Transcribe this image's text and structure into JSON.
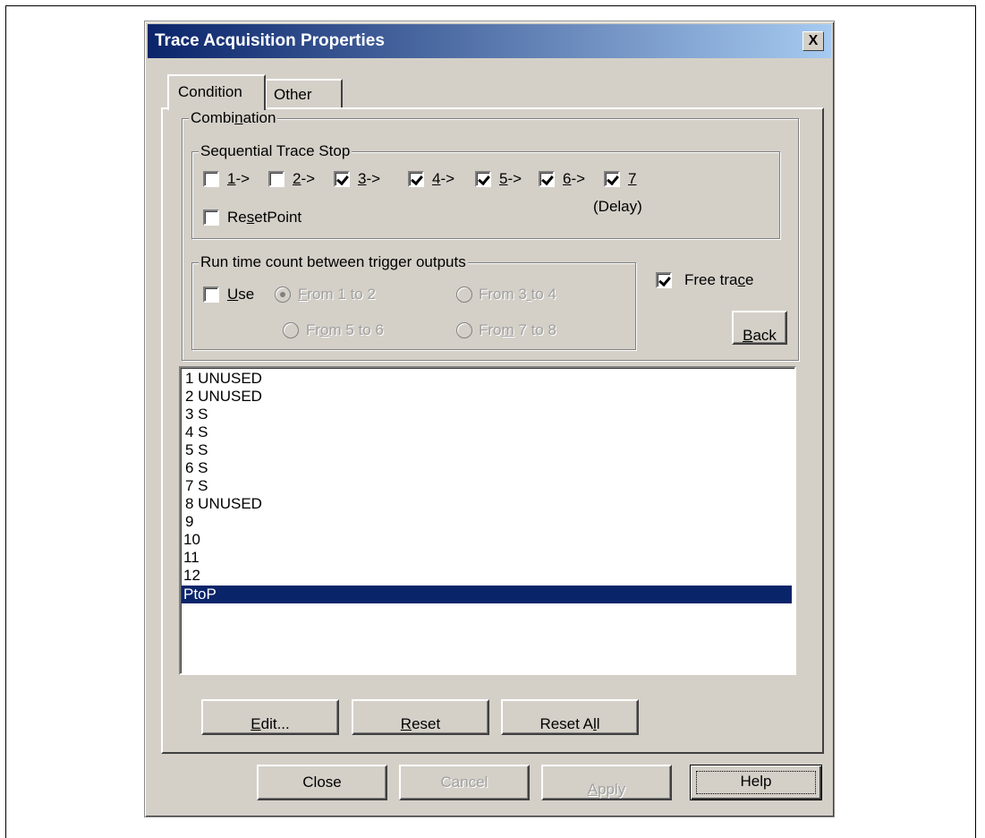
{
  "dialog": {
    "title": "Trace Acquisition Properties",
    "close_glyph": "X"
  },
  "tabs": [
    {
      "label": "Condition"
    },
    {
      "label": "Other"
    }
  ],
  "combination": {
    "label_pre": "Combi",
    "label_u": "n",
    "label_post": "ation"
  },
  "seq": {
    "label": "Sequential Trace Stop",
    "steps": [
      {
        "num": "1",
        "suffix": "->",
        "checked": false
      },
      {
        "num": "2",
        "suffix": "->",
        "checked": false
      },
      {
        "num": "3",
        "suffix": "->",
        "checked": true
      },
      {
        "num": "4",
        "suffix": "->",
        "checked": true
      },
      {
        "num": "5",
        "suffix": "->",
        "checked": true
      },
      {
        "num": "6",
        "suffix": "->",
        "checked": true
      },
      {
        "num": "7",
        "suffix": "",
        "checked": true
      }
    ],
    "delay": "(Delay)",
    "reset_pre": "Re",
    "reset_u": "s",
    "reset_post": "etPoint",
    "reset_checked": false
  },
  "runtime": {
    "label": "Run time count between trigger outputs",
    "use_u": "U",
    "use_post": "se",
    "use_checked": false,
    "from12_u": "F",
    "from12_post": "rom 1 to 2",
    "from34_pre": "From 3",
    "from34_u": " ",
    "from34_post": "to 4",
    "from56_pre": "Fr",
    "from56_u": "o",
    "from56_post": "m 5 to 6",
    "from78_pre": "Fro",
    "from78_u": "m",
    "from78_post": " 7 to 8"
  },
  "free_trace": {
    "pre": "Free tra",
    "u": "c",
    "post": "e",
    "checked": true
  },
  "back_button": {
    "u": "B",
    "post": "ack"
  },
  "list": {
    "items": [
      "1 UNUSED",
      "2 UNUSED",
      "3 S",
      "4 S",
      "5 S",
      "6 S",
      "7 S",
      "8 UNUSED",
      "9",
      "10",
      "11",
      "12",
      "PtoP"
    ],
    "selected_index": 12
  },
  "panel_buttons": {
    "edit_u": "E",
    "edit_post": "dit...",
    "reset_u": "R",
    "reset_post": "eset",
    "resetall_pre": "Reset A",
    "resetall_u": "l",
    "resetall_post": "l"
  },
  "footer_buttons": {
    "close": "Close",
    "cancel": "Cancel",
    "apply_u": "A",
    "apply_post": "pply",
    "help": "Help"
  },
  "colors": {
    "face": "#d4d0c8",
    "title_start": "#0a246a",
    "title_end": "#a6caf0",
    "selection": "#0a246a"
  }
}
